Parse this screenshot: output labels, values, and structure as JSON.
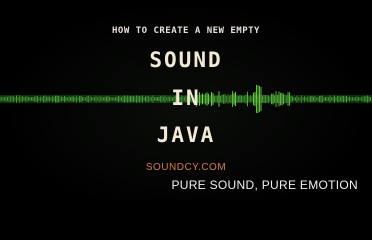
{
  "kicker": "HOW TO CREATE A NEW EMPTY",
  "headline_lines": [
    "SOUND",
    "IN",
    "JAVA"
  ],
  "brand": "SOUNDCY.COM",
  "tagline": "PURE SOUND, PURE EMOTION",
  "colors": {
    "background": "#000000",
    "kicker": "#e6e1da",
    "headline": "#f2ead4",
    "brand": "#d87b46",
    "tagline": "#f0f0f0",
    "wave": "#3fa832",
    "wave_bright": "#74e04a"
  }
}
